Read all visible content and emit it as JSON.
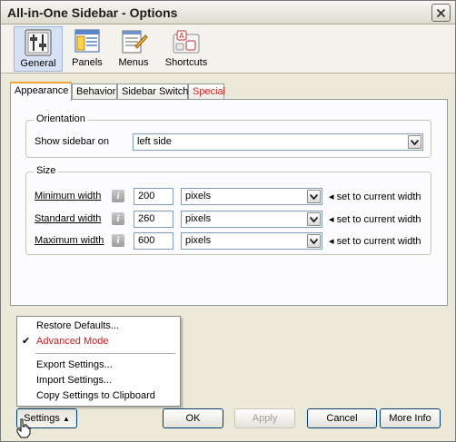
{
  "window": {
    "title": "All-in-One Sidebar - Options"
  },
  "icons": {
    "close": "close-icon",
    "general": "sliders-icon",
    "panels": "panels-icon",
    "menus": "menus-icon",
    "shortcuts": "shortcuts-icon",
    "info": "info-icon",
    "dropdown": "chevron-down-icon",
    "check": "checkmark-icon",
    "cursor": "hand-cursor-icon"
  },
  "toolbar": {
    "items": [
      {
        "label": "General",
        "active": true
      },
      {
        "label": "Panels"
      },
      {
        "label": "Menus"
      },
      {
        "label": "Shortcuts"
      }
    ]
  },
  "tabs": [
    {
      "label": "Appearance",
      "active": true
    },
    {
      "label": "Behavior"
    },
    {
      "label": "Sidebar Switch"
    },
    {
      "label": "Special",
      "color": "#d42020"
    }
  ],
  "orientation": {
    "legend": "Orientation",
    "label": "Show sidebar on",
    "value": "left side"
  },
  "size": {
    "legend": "Size",
    "rows": [
      {
        "label": "Minimum width",
        "value": "200",
        "unit": "pixels",
        "action": "set to current width"
      },
      {
        "label": "Standard width",
        "value": "260",
        "unit": "pixels",
        "action": "set to current width"
      },
      {
        "label": "Maximum width",
        "value": "600",
        "unit": "pixels",
        "action": "set to current width"
      }
    ]
  },
  "menu": {
    "items": [
      {
        "label": "Restore Defaults..."
      },
      {
        "label": "Advanced Mode",
        "checked": true,
        "color": "#c81e1e"
      },
      {
        "label": "Export Settings..."
      },
      {
        "label": "Import Settings..."
      },
      {
        "label": "Copy Settings to Clipboard"
      }
    ]
  },
  "buttons": {
    "settings": "Settings",
    "ok": "OK",
    "apply": "Apply",
    "cancel": "Cancel",
    "more_info": "More Info"
  }
}
